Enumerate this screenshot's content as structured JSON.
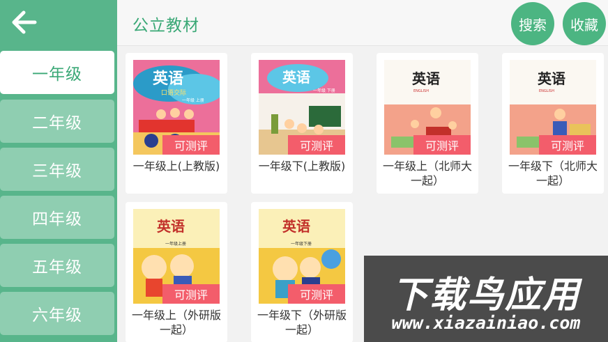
{
  "header": {
    "title": "公立教材",
    "search_label": "搜索",
    "favorite_label": "收藏"
  },
  "sidebar": {
    "grades": [
      {
        "label": "一年级",
        "active": true
      },
      {
        "label": "二年级"
      },
      {
        "label": "三年级"
      },
      {
        "label": "四年级"
      },
      {
        "label": "五年级"
      },
      {
        "label": "六年级"
      }
    ]
  },
  "books": [
    {
      "cover_title": "英语",
      "cover_sub": "口语交际",
      "cover_grade": "一年级 上册",
      "badge": "可测评",
      "title": "一年级上(上教版)"
    },
    {
      "cover_title": "英语",
      "cover_sub": "",
      "cover_grade": "一年级 下册",
      "badge": "可测评",
      "title": "一年级下(上教版)"
    },
    {
      "cover_title": "英语",
      "cover_sub": "ENGLISH",
      "cover_grade": "",
      "badge": "可测评",
      "title": "一年级上（北师大一起）"
    },
    {
      "cover_title": "英语",
      "cover_sub": "ENGLISH",
      "cover_grade": "",
      "badge": "可测评",
      "title": "一年级下（北师大一起）"
    },
    {
      "cover_title": "英语",
      "cover_sub": "",
      "cover_grade": "一年级上册",
      "badge": "可测评",
      "title": "一年级上（外研版一起）"
    },
    {
      "cover_title": "英语",
      "cover_sub": "",
      "cover_grade": "一年级下册",
      "badge": "可测评",
      "title": "一年级下（外研版一起）"
    }
  ],
  "watermark": {
    "text": "下载鸟应用",
    "url": "www.xiazainiao.com"
  },
  "colors": {
    "primary": "#4cb582",
    "sidebar": "#58b58b",
    "badge": "#f35d6b"
  }
}
